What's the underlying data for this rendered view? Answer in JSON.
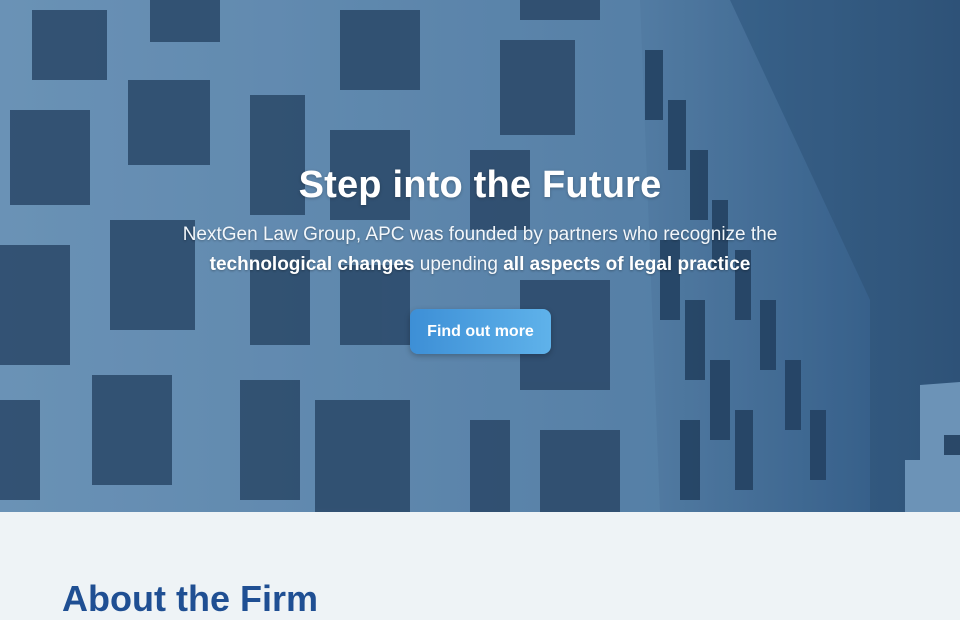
{
  "hero": {
    "title": "Step into the Future",
    "subtitle_line1": "NextGen Law Group, APC was founded by partners who recognize the",
    "subtitle_bold1": "technological changes",
    "subtitle_mid": " upending ",
    "subtitle_bold2": "all aspects of legal practice",
    "cta_label": "Find out more",
    "background_image": "office-building-photo"
  },
  "about": {
    "title": "About the Firm"
  },
  "colors": {
    "accent": "#3d8fd6",
    "heading_blue": "#1f4f93",
    "hero_overlay": "#4d7aa2",
    "section_bg": "#eef3f6"
  }
}
